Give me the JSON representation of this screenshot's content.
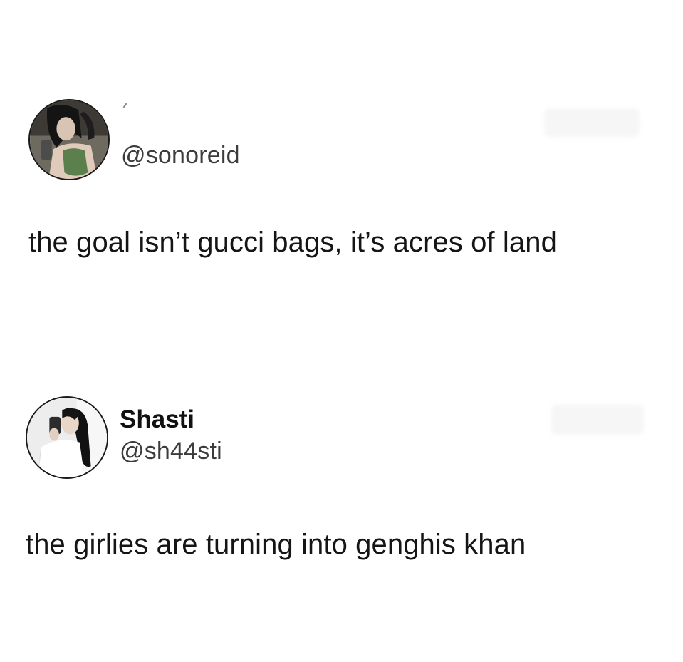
{
  "tweets": [
    {
      "handle": "@sonoreid",
      "text": "the goal isn’t gucci bags, it’s acres of land",
      "avatar_icon": "profile-photo-icon"
    },
    {
      "display_name": "Shasti",
      "handle": "@sh44sti",
      "text": "the girlies are turning into genghis khan",
      "avatar_icon": "profile-photo-icon"
    }
  ],
  "colors": {
    "background": "#ffffff",
    "text": "#151515",
    "handle": "#3c3c3c"
  }
}
